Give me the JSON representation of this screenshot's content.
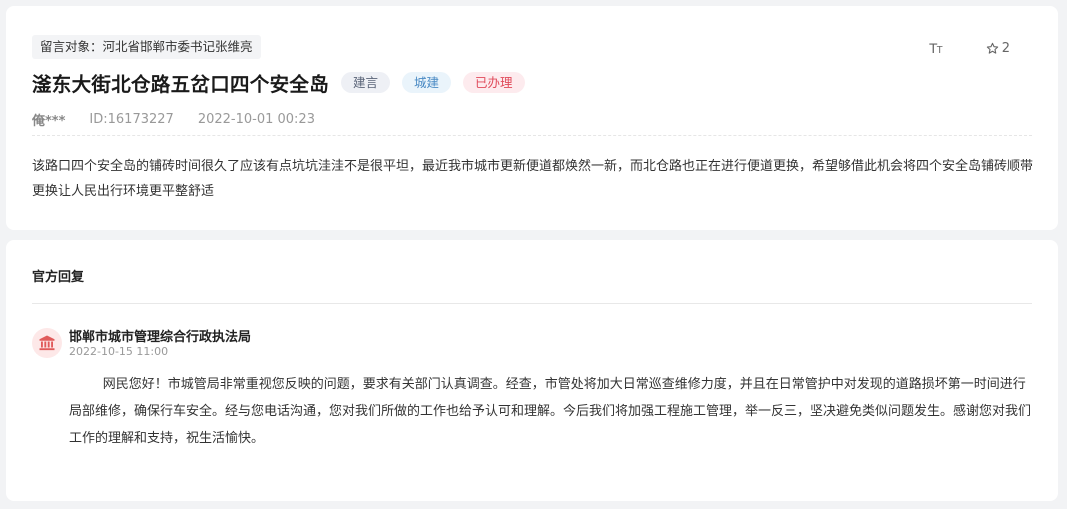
{
  "message": {
    "target": "留言对象：河北省邯郸市委书记张维亮",
    "title": "滏东大街北仓路五岔口四个安全岛",
    "badges": [
      "建言",
      "城建",
      "已办理"
    ],
    "author": "俺***",
    "id": "ID:16173227",
    "datetime": "2022-10-01 00:23",
    "content": "该路口四个安全岛的铺砖时间很久了应该有点坑坑洼洼不是很平坦，最近我市城市更新便道都焕然一新，而北仓路也正在进行便道更换，希望够借此机会将四个安全岛铺砖顺带更换让人民出行环境更平整舒适"
  },
  "tools": {
    "font_icon_label": "Tт",
    "favorite_count": "2"
  },
  "reply": {
    "heading": "官方回复",
    "department": "邯郸市城市管理综合行政执法局",
    "datetime": "2022-10-15 11:00",
    "text": "网民您好！市城管局非常重视您反映的问题，要求有关部门认真调查。经查，市管处将加大日常巡查维修力度，并且在日常管护中对发现的道路损坏第一时间进行局部维修，确保行车安全。经与您电话沟通，您对我们所做的工作也给予认可和理解。今后我们将加强工程施工管理，举一反三，坚决避免类似问题发生。感谢您对我们工作的理解和支持，祝生活愉快。"
  },
  "icons": {
    "font_size": "font-size-icon",
    "favorite": "star-outline-icon",
    "department": "government-building-icon"
  },
  "colors": {
    "page_bg": "#f2f3f5",
    "badge_suggest": "#5a6478",
    "badge_category": "#4a8ac4",
    "badge_status": "#e04a5a",
    "avatar_accent": "#e05a5a"
  }
}
